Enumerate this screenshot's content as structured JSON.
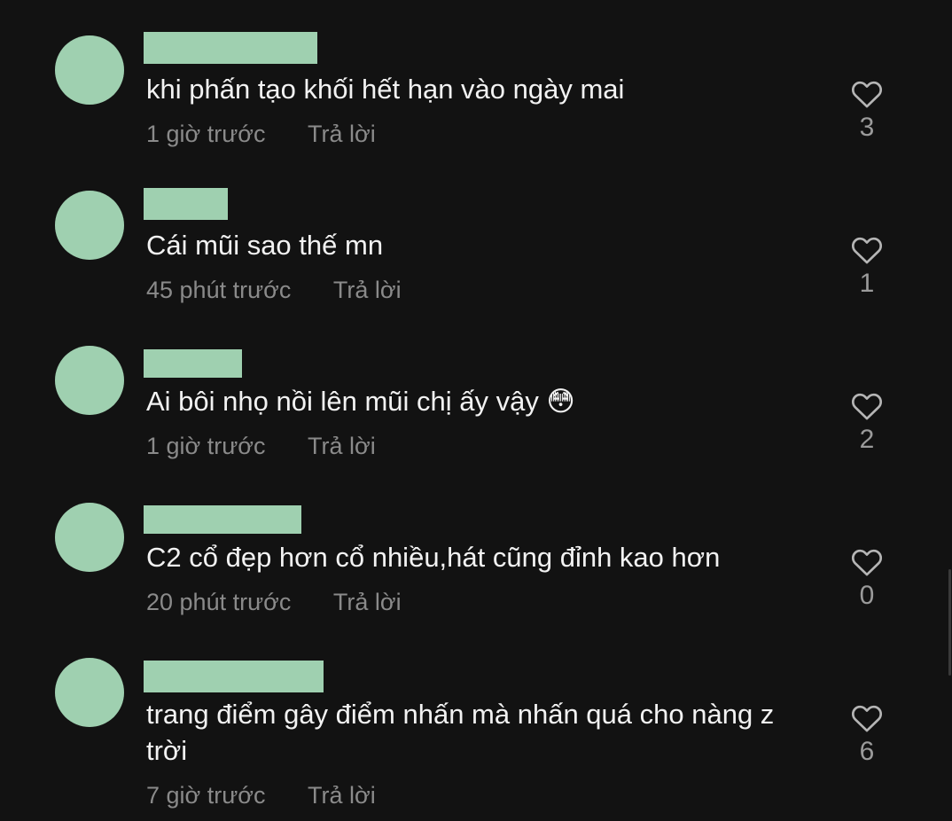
{
  "comments": [
    {
      "text": "khi phấn tạo khối hết hạn vào ngày mai",
      "time": "1 giờ trước",
      "reply": "Trả lời",
      "likes": "3"
    },
    {
      "text": "Cái mũi sao thế mn",
      "time": "45 phút trước",
      "reply": "Trả lời",
      "likes": "1"
    },
    {
      "text": "Ai bôi nhọ nồi lên mũi chị ấy vậy 😳",
      "time": "1 giờ trước",
      "reply": "Trả lời",
      "likes": "2"
    },
    {
      "text": "C2 cổ đẹp hơn cổ nhiều,hát cũng đỉnh kao hơn",
      "time": "20 phút trước",
      "reply": "Trả lời",
      "likes": "0"
    },
    {
      "text": "trang điểm gây điểm nhấn mà nhấn quá cho nàng z\ntrời",
      "time": "7 giờ trước",
      "reply": "Trả lời",
      "likes": "6"
    }
  ],
  "icons": {
    "like": "heart-outline-icon"
  },
  "colors": {
    "background": "#121212",
    "text": "#f2f2f2",
    "muted": "#8a8a8a",
    "redaction": "#9fd0b0"
  }
}
